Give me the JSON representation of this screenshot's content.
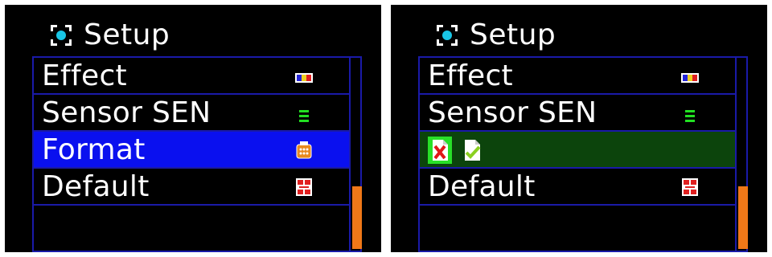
{
  "colors": {
    "background": "#000000",
    "border": "#1a1aa8",
    "selected_blue": "#0a10ef",
    "selected_green": "#0c440c",
    "scroll_thumb": "#f07818",
    "text": "#ffffff"
  },
  "screens": [
    {
      "header": {
        "icon": "setup-icon",
        "title": "Setup"
      },
      "menu": [
        {
          "label": "Effect",
          "icon": "effect-icon"
        },
        {
          "label": "Sensor SEN",
          "icon": "sensor-icon"
        },
        {
          "label": "Format",
          "icon": "format-icon",
          "selected": true
        },
        {
          "label": "Default",
          "icon": "default-icon"
        }
      ],
      "scroll_position": "bottom"
    },
    {
      "header": {
        "icon": "setup-icon",
        "title": "Setup"
      },
      "menu": [
        {
          "label": "Effect",
          "icon": "effect-icon"
        },
        {
          "label": "Sensor SEN",
          "icon": "sensor-icon"
        },
        {
          "label": "",
          "options": [
            {
              "icon": "cancel-format-icon",
              "active": true
            },
            {
              "icon": "confirm-format-icon",
              "active": false
            }
          ]
        },
        {
          "label": "Default",
          "icon": "default-icon"
        }
      ],
      "scroll_position": "bottom"
    }
  ]
}
